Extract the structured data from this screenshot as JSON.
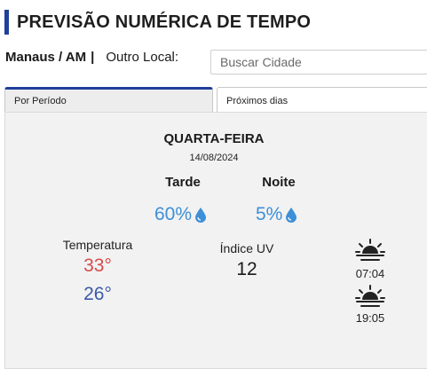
{
  "header": {
    "title": "PREVISÃO NUMÉRICA DE TEMPO"
  },
  "location": {
    "current": "Manaus / AM",
    "separator": "|",
    "other_label": "Outro Local:",
    "search_placeholder": "Buscar Cidade",
    "search_value": ""
  },
  "tabs": [
    {
      "label": "Por Período",
      "active": true
    },
    {
      "label": "Próximos dias",
      "active": false
    }
  ],
  "forecast": {
    "day": "QUARTA-FEIRA",
    "date": "14/08/2024",
    "periods": [
      {
        "name": "Tarde",
        "rain_chance": "60%"
      },
      {
        "name": "Noite",
        "rain_chance": "5%"
      }
    ],
    "temperature": {
      "label": "Temperatura",
      "max": "33°",
      "min": "26°"
    },
    "uv": {
      "label": "Índice UV",
      "value": "12"
    },
    "sunrise": {
      "time": "07:04",
      "icon": "sunrise-icon"
    },
    "sunset": {
      "time": "19:05",
      "icon": "sunset-icon"
    }
  },
  "colors": {
    "accent": "#1f3f9a",
    "rain": "#3d8fd8",
    "temp_max": "#d84a4a",
    "temp_min": "#3b5aa8"
  }
}
